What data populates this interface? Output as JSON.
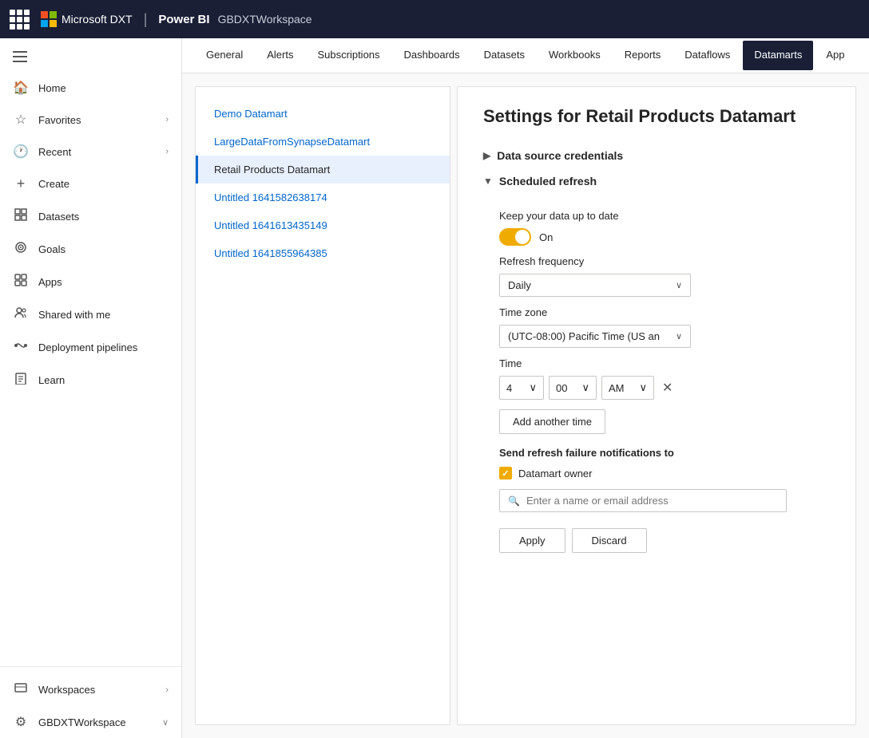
{
  "topbar": {
    "apps_icon_label": "apps",
    "brand_name": "Microsoft DXT",
    "divider": "|",
    "product_name": "Power BI",
    "workspace_name": "GBDXTWorkspace"
  },
  "sidebar": {
    "hamburger_label": "menu",
    "items": [
      {
        "id": "home",
        "label": "Home",
        "icon": "🏠",
        "has_chevron": false
      },
      {
        "id": "favorites",
        "label": "Favorites",
        "icon": "☆",
        "has_chevron": true
      },
      {
        "id": "recent",
        "label": "Recent",
        "icon": "🕐",
        "has_chevron": true
      },
      {
        "id": "create",
        "label": "Create",
        "icon": "+",
        "has_chevron": false
      },
      {
        "id": "datasets",
        "label": "Datasets",
        "icon": "⊞",
        "has_chevron": false
      },
      {
        "id": "goals",
        "label": "Goals",
        "icon": "🎯",
        "has_chevron": false
      },
      {
        "id": "apps",
        "label": "Apps",
        "icon": "⬜",
        "has_chevron": false
      },
      {
        "id": "shared-with-me",
        "label": "Shared with me",
        "icon": "👤",
        "has_chevron": false
      },
      {
        "id": "deployment-pipelines",
        "label": "Deployment pipelines",
        "icon": "🚀",
        "has_chevron": false
      },
      {
        "id": "learn",
        "label": "Learn",
        "icon": "📖",
        "has_chevron": false
      }
    ],
    "bottom_items": [
      {
        "id": "workspaces",
        "label": "Workspaces",
        "icon": "🏢",
        "has_chevron": true
      },
      {
        "id": "gbdxt-workspace",
        "label": "GBDXTWorkspace",
        "icon": "⚙",
        "has_chevron": true
      }
    ]
  },
  "tabs": [
    {
      "id": "general",
      "label": "General",
      "active": false
    },
    {
      "id": "alerts",
      "label": "Alerts",
      "active": false
    },
    {
      "id": "subscriptions",
      "label": "Subscriptions",
      "active": false
    },
    {
      "id": "dashboards",
      "label": "Dashboards",
      "active": false
    },
    {
      "id": "datasets",
      "label": "Datasets",
      "active": false
    },
    {
      "id": "workbooks",
      "label": "Workbooks",
      "active": false
    },
    {
      "id": "reports",
      "label": "Reports",
      "active": false
    },
    {
      "id": "dataflows",
      "label": "Dataflows",
      "active": false
    },
    {
      "id": "datamarts",
      "label": "Datamarts",
      "active": true
    },
    {
      "id": "app",
      "label": "App",
      "active": false
    }
  ],
  "datamart_list": {
    "items": [
      {
        "id": "demo-datamart",
        "label": "Demo Datamart",
        "selected": false
      },
      {
        "id": "large-data",
        "label": "LargeDataFromSynapseDatamart",
        "selected": false
      },
      {
        "id": "retail-products",
        "label": "Retail Products Datamart",
        "selected": true
      },
      {
        "id": "untitled-1",
        "label": "Untitled 1641582638174",
        "selected": false
      },
      {
        "id": "untitled-2",
        "label": "Untitled 1641613435149",
        "selected": false
      },
      {
        "id": "untitled-3",
        "label": "Untitled 1641855964385",
        "selected": false
      }
    ]
  },
  "settings": {
    "title": "Settings for Retail Products Datamart",
    "data_source_section": {
      "label": "Data source credentials",
      "collapsed": true
    },
    "scheduled_refresh": {
      "label": "Scheduled refresh",
      "keep_data_label": "Keep your data up to date",
      "toggle_label": "On",
      "toggle_on": true,
      "refresh_frequency_label": "Refresh frequency",
      "refresh_frequency_value": "Daily",
      "time_zone_label": "Time zone",
      "time_zone_value": "(UTC-08:00) Pacific Time (US an",
      "time_label": "Time",
      "time_hour": "4",
      "time_minute": "00",
      "time_ampm": "AM",
      "add_time_label": "Add another time",
      "notification_label": "Send refresh failure notifications to",
      "datamart_owner_label": "Datamart owner",
      "datamart_owner_checked": true,
      "email_placeholder": "Enter a name or email address",
      "apply_label": "Apply",
      "discard_label": "Discard"
    }
  }
}
